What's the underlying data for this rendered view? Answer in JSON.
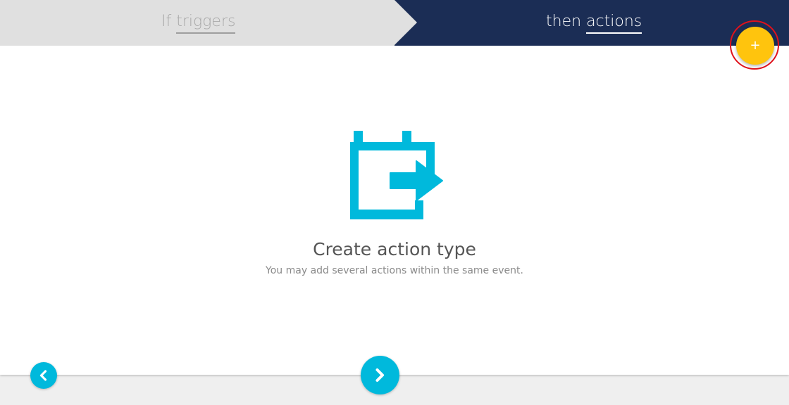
{
  "steps": {
    "trigger": {
      "prefix": "If",
      "word": "triggers"
    },
    "action": {
      "prefix": "then",
      "word": "actions"
    }
  },
  "add_button": {
    "label": "+",
    "icon": "plus-icon",
    "color": "#ffc40d"
  },
  "empty_state": {
    "icon": "calendar-arrow-icon",
    "title": "Create action type",
    "subtitle": "You may add several actions within the same event."
  },
  "navigation": {
    "prev_icon": "chevron-left-icon",
    "next_icon": "chevron-right-icon",
    "color": "#00b9dc"
  },
  "colors": {
    "header_active": "#1b2d55",
    "header_inactive": "#e0e0e0",
    "accent": "#00b9dc",
    "highlight_ring": "#e0121c"
  }
}
